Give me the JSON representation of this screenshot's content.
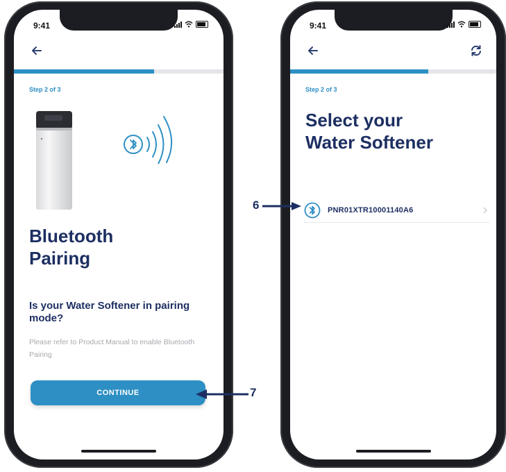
{
  "screen1": {
    "time": "9:41",
    "progress_fraction": 0.67,
    "step": "Step 2 of 3",
    "title_line1": "Bluetooth",
    "title_line2": "Pairing",
    "question": "Is your Water Softener in pairing mode?",
    "hint": "Please refer to Product Manual to enable Bluetooth Pairing",
    "continue_label": "CONTINUE"
  },
  "screen2": {
    "time": "9:41",
    "progress_fraction": 0.67,
    "step": "Step 2 of 3",
    "title_line1": "Select your",
    "title_line2": "Water Softener",
    "device_name": "PNR01XTR10001140A6"
  },
  "callouts": {
    "six": "6",
    "seven": "7"
  },
  "colors": {
    "accent": "#2d8fc4",
    "navy": "#1d2f62",
    "muted": "#a6a9ae",
    "track": "#e3e5e9"
  },
  "icons": [
    "back-arrow-icon",
    "refresh-icon",
    "bluetooth-icon",
    "bluetooth-waves-icon",
    "chevron-right-icon",
    "water-softener-image",
    "signal-icon",
    "wifi-icon",
    "battery-icon"
  ]
}
